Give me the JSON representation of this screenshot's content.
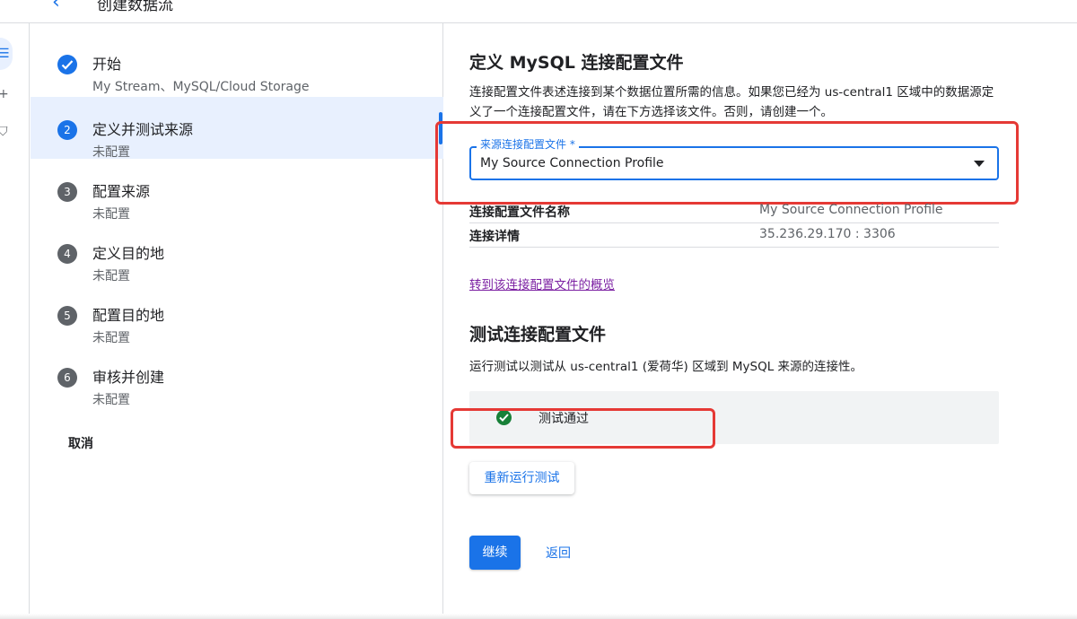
{
  "header": {
    "title": "创建数据流",
    "back_icon": "arrow-back-icon"
  },
  "stepper": {
    "steps": [
      {
        "number": "",
        "title": "开始",
        "subtitle": "My Stream、MySQL/Cloud Storage",
        "state": "done"
      },
      {
        "number": "2",
        "title": "定义并测试来源",
        "subtitle": "未配置",
        "state": "active"
      },
      {
        "number": "3",
        "title": "配置来源",
        "subtitle": "未配置",
        "state": "pending"
      },
      {
        "number": "4",
        "title": "定义目的地",
        "subtitle": "未配置",
        "state": "pending"
      },
      {
        "number": "5",
        "title": "配置目的地",
        "subtitle": "未配置",
        "state": "pending"
      },
      {
        "number": "6",
        "title": "审核并创建",
        "subtitle": "未配置",
        "state": "pending"
      }
    ],
    "cancel_label": "取消"
  },
  "main": {
    "section_title": "定义 MySQL 连接配置文件",
    "description": "连接配置文件表述连接到某个数据位置所需的信息。如果您已经为 us-central1 区域中的数据源定义了一个连接配置文件，请在下方选择该文件。否则，请创建一个。",
    "source_profile": {
      "label": "来源连接配置文件 *",
      "value": "My Source Connection Profile"
    },
    "details": [
      {
        "key": "连接配置文件名称",
        "value": "My Source Connection Profile"
      },
      {
        "key": "连接详情",
        "value": "35.236.29.170 : 3306"
      }
    ],
    "overview_link": "转到该连接配置文件的概览",
    "test_title": "测试连接配置文件",
    "test_description": "运行测试以测试从 us-central1 (爱荷华) 区域到 MySQL 来源的连接性。",
    "test_result": "测试通过",
    "rerun_label": "重新运行测试",
    "continue_label": "继续",
    "back_label": "返回"
  },
  "colors": {
    "accent": "#1a73e8",
    "success": "#188038",
    "annotation": "#e53935",
    "link_visited": "#7b1fa2"
  }
}
